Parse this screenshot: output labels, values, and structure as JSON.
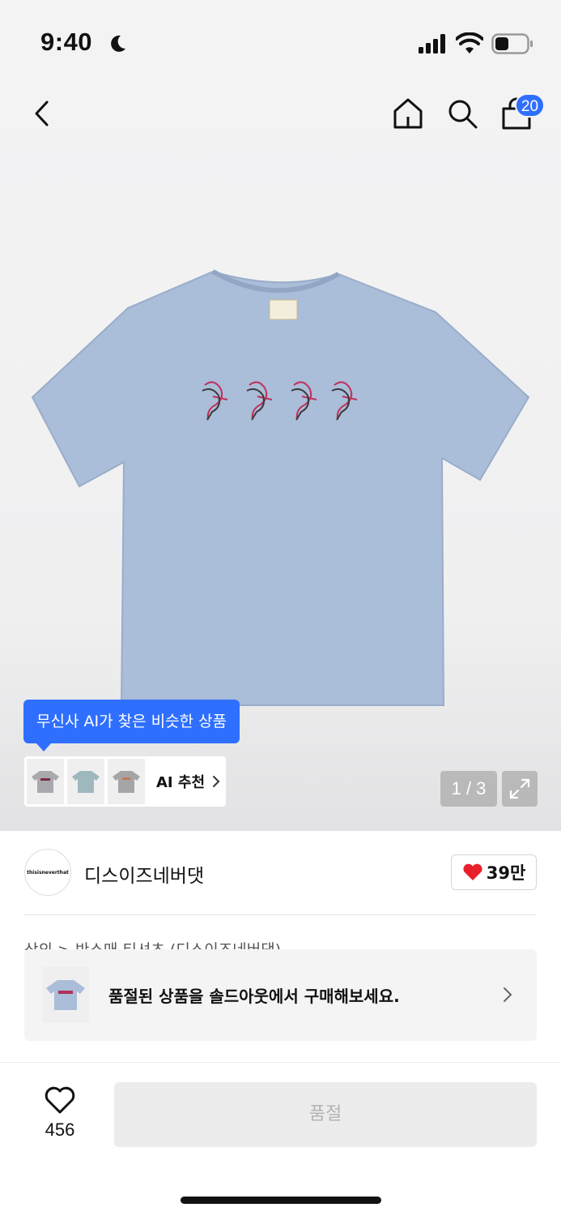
{
  "status": {
    "time": "9:40"
  },
  "header": {
    "cart_count": "20"
  },
  "hero": {
    "ai_tooltip": "무신사 AI가 찾은 비슷한 상품",
    "ai_label": "AI 추천",
    "page_indicator": "1 / 3"
  },
  "brand": {
    "name": "디스이즈네버댓",
    "logo_text": "thisisneverthat",
    "likes": "39만"
  },
  "product": {
    "title_partial": "상의 > 반소매 티셔츠 (디스이즈네버댓)"
  },
  "soldout_banner": {
    "text": "품절된 상품을 솔드아웃에서 구매해보세요."
  },
  "bottom": {
    "fav_count": "456",
    "buy_button": "품절"
  },
  "colors": {
    "accent": "#2f6fff",
    "heart": "#e8202a",
    "shirt": "#a9bcd9"
  }
}
